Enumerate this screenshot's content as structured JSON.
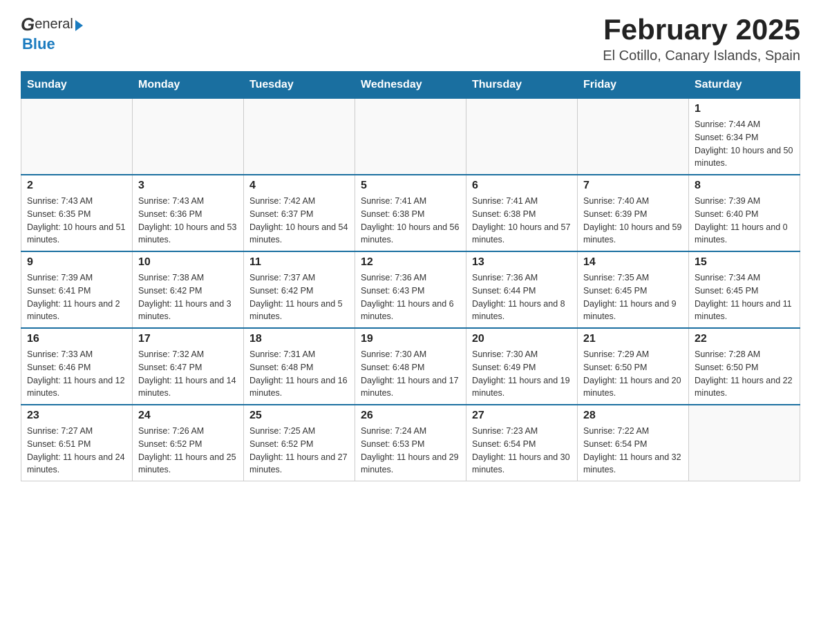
{
  "logo": {
    "text_general": "General",
    "text_blue": "Blue",
    "arrow_char": "▶"
  },
  "header": {
    "title": "February 2025",
    "subtitle": "El Cotillo, Canary Islands, Spain"
  },
  "days_of_week": [
    "Sunday",
    "Monday",
    "Tuesday",
    "Wednesday",
    "Thursday",
    "Friday",
    "Saturday"
  ],
  "weeks": [
    [
      {
        "day": "",
        "info": ""
      },
      {
        "day": "",
        "info": ""
      },
      {
        "day": "",
        "info": ""
      },
      {
        "day": "",
        "info": ""
      },
      {
        "day": "",
        "info": ""
      },
      {
        "day": "",
        "info": ""
      },
      {
        "day": "1",
        "info": "Sunrise: 7:44 AM\nSunset: 6:34 PM\nDaylight: 10 hours and 50 minutes."
      }
    ],
    [
      {
        "day": "2",
        "info": "Sunrise: 7:43 AM\nSunset: 6:35 PM\nDaylight: 10 hours and 51 minutes."
      },
      {
        "day": "3",
        "info": "Sunrise: 7:43 AM\nSunset: 6:36 PM\nDaylight: 10 hours and 53 minutes."
      },
      {
        "day": "4",
        "info": "Sunrise: 7:42 AM\nSunset: 6:37 PM\nDaylight: 10 hours and 54 minutes."
      },
      {
        "day": "5",
        "info": "Sunrise: 7:41 AM\nSunset: 6:38 PM\nDaylight: 10 hours and 56 minutes."
      },
      {
        "day": "6",
        "info": "Sunrise: 7:41 AM\nSunset: 6:38 PM\nDaylight: 10 hours and 57 minutes."
      },
      {
        "day": "7",
        "info": "Sunrise: 7:40 AM\nSunset: 6:39 PM\nDaylight: 10 hours and 59 minutes."
      },
      {
        "day": "8",
        "info": "Sunrise: 7:39 AM\nSunset: 6:40 PM\nDaylight: 11 hours and 0 minutes."
      }
    ],
    [
      {
        "day": "9",
        "info": "Sunrise: 7:39 AM\nSunset: 6:41 PM\nDaylight: 11 hours and 2 minutes."
      },
      {
        "day": "10",
        "info": "Sunrise: 7:38 AM\nSunset: 6:42 PM\nDaylight: 11 hours and 3 minutes."
      },
      {
        "day": "11",
        "info": "Sunrise: 7:37 AM\nSunset: 6:42 PM\nDaylight: 11 hours and 5 minutes."
      },
      {
        "day": "12",
        "info": "Sunrise: 7:36 AM\nSunset: 6:43 PM\nDaylight: 11 hours and 6 minutes."
      },
      {
        "day": "13",
        "info": "Sunrise: 7:36 AM\nSunset: 6:44 PM\nDaylight: 11 hours and 8 minutes."
      },
      {
        "day": "14",
        "info": "Sunrise: 7:35 AM\nSunset: 6:45 PM\nDaylight: 11 hours and 9 minutes."
      },
      {
        "day": "15",
        "info": "Sunrise: 7:34 AM\nSunset: 6:45 PM\nDaylight: 11 hours and 11 minutes."
      }
    ],
    [
      {
        "day": "16",
        "info": "Sunrise: 7:33 AM\nSunset: 6:46 PM\nDaylight: 11 hours and 12 minutes."
      },
      {
        "day": "17",
        "info": "Sunrise: 7:32 AM\nSunset: 6:47 PM\nDaylight: 11 hours and 14 minutes."
      },
      {
        "day": "18",
        "info": "Sunrise: 7:31 AM\nSunset: 6:48 PM\nDaylight: 11 hours and 16 minutes."
      },
      {
        "day": "19",
        "info": "Sunrise: 7:30 AM\nSunset: 6:48 PM\nDaylight: 11 hours and 17 minutes."
      },
      {
        "day": "20",
        "info": "Sunrise: 7:30 AM\nSunset: 6:49 PM\nDaylight: 11 hours and 19 minutes."
      },
      {
        "day": "21",
        "info": "Sunrise: 7:29 AM\nSunset: 6:50 PM\nDaylight: 11 hours and 20 minutes."
      },
      {
        "day": "22",
        "info": "Sunrise: 7:28 AM\nSunset: 6:50 PM\nDaylight: 11 hours and 22 minutes."
      }
    ],
    [
      {
        "day": "23",
        "info": "Sunrise: 7:27 AM\nSunset: 6:51 PM\nDaylight: 11 hours and 24 minutes."
      },
      {
        "day": "24",
        "info": "Sunrise: 7:26 AM\nSunset: 6:52 PM\nDaylight: 11 hours and 25 minutes."
      },
      {
        "day": "25",
        "info": "Sunrise: 7:25 AM\nSunset: 6:52 PM\nDaylight: 11 hours and 27 minutes."
      },
      {
        "day": "26",
        "info": "Sunrise: 7:24 AM\nSunset: 6:53 PM\nDaylight: 11 hours and 29 minutes."
      },
      {
        "day": "27",
        "info": "Sunrise: 7:23 AM\nSunset: 6:54 PM\nDaylight: 11 hours and 30 minutes."
      },
      {
        "day": "28",
        "info": "Sunrise: 7:22 AM\nSunset: 6:54 PM\nDaylight: 11 hours and 32 minutes."
      },
      {
        "day": "",
        "info": ""
      }
    ]
  ]
}
